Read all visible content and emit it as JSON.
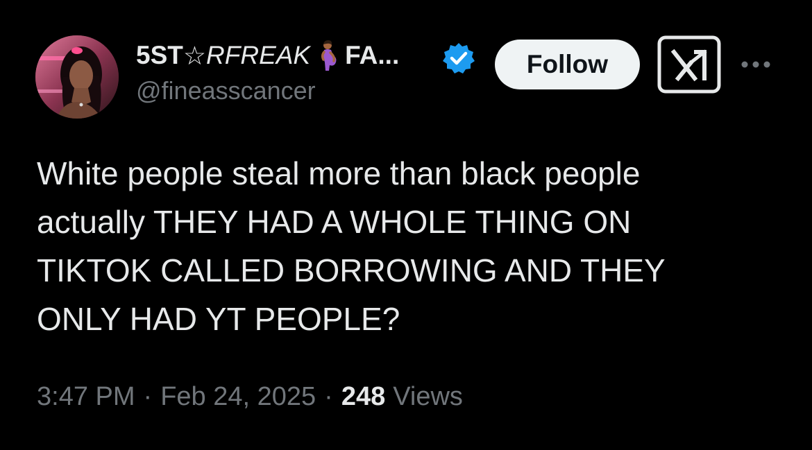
{
  "author": {
    "display_name_prefix": "5ST",
    "display_name_star": "☆",
    "display_name_italic": "RFREAK",
    "display_name_emoji": "pregnant-woman-emoji",
    "display_name_suffix": "FA...",
    "handle": "@fineasscancer",
    "verified_icon": "verified-badge-icon",
    "verified_color": "#1d9bf0"
  },
  "actions": {
    "follow_label": "Follow",
    "grok_icon": "grok-icon",
    "more_icon": "more-options-icon"
  },
  "tweet": {
    "text_lines": [
      "White people steal more than black people",
      "actually THEY HAD A WHOLE THING ON",
      "TIKTOK CALLED BORROWING AND THEY",
      "ONLY HAD YT PEOPLE?"
    ]
  },
  "meta": {
    "time": "3:47 PM",
    "separator": "·",
    "date": "Feb 24, 2025",
    "views_count": "248",
    "views_label": "Views"
  }
}
